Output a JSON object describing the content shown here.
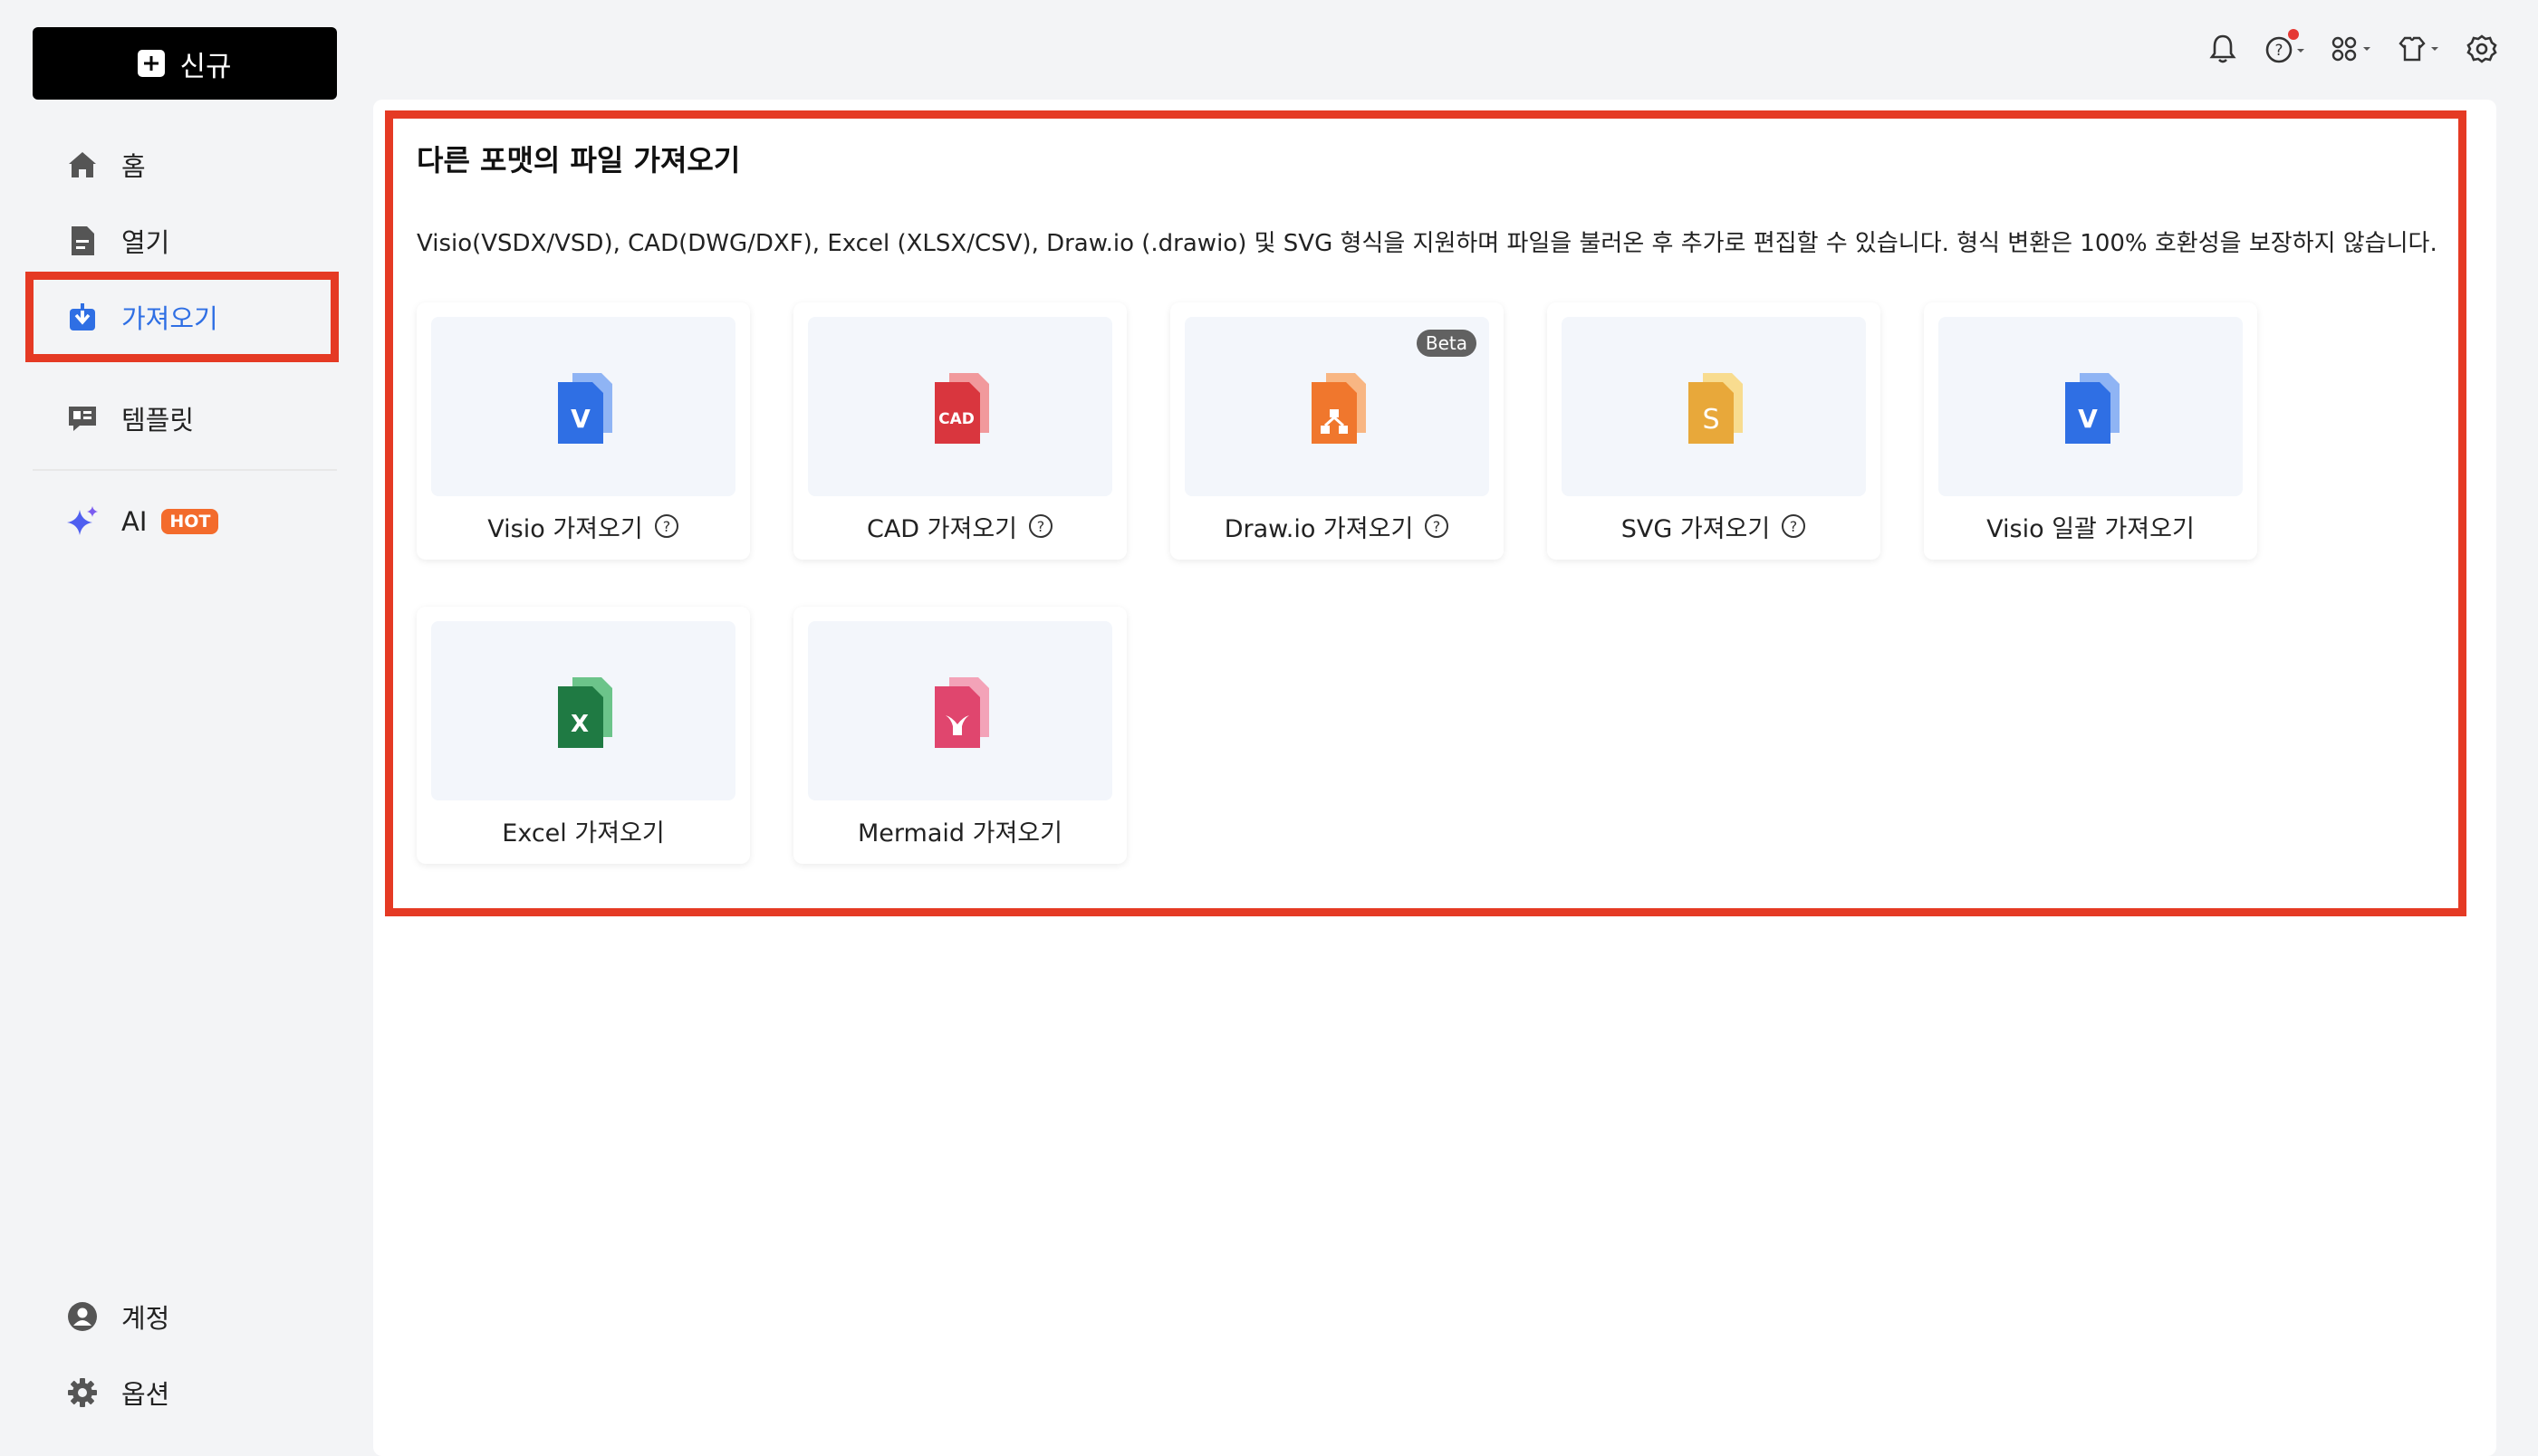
{
  "sidebar": {
    "new_label": "신규",
    "items": [
      {
        "label": "홈",
        "icon": "home-icon"
      },
      {
        "label": "열기",
        "icon": "document-icon"
      },
      {
        "label": "가져오기",
        "icon": "import-icon"
      },
      {
        "label": "템플릿",
        "icon": "template-icon"
      },
      {
        "label": "AI",
        "icon": "sparkle-icon",
        "badge": "HOT"
      }
    ],
    "bottom": [
      {
        "label": "계정",
        "icon": "account-icon"
      },
      {
        "label": "옵션",
        "icon": "gear-icon"
      }
    ]
  },
  "topbar": {
    "icons": [
      "bell-icon",
      "help-icon",
      "apps-icon",
      "shirt-icon",
      "settings-icon"
    ]
  },
  "main": {
    "title": "다른 포맷의 파일 가져오기",
    "description": "Visio(VSDX/VSD), CAD(DWG/DXF), Excel (XLSX/CSV), Draw.io (.drawio) 및 SVG 형식을 지원하며 파일을 불러온 후 추가로 편집할 수 있습니다. 형식 변환은 100% 호환성을 보장하지 않습니다.",
    "cards": [
      {
        "label": "Visio 가져오기",
        "icon": "visio-file-icon",
        "glyph": "V",
        "help": true
      },
      {
        "label": "CAD 가져오기",
        "icon": "cad-file-icon",
        "glyph": "CAD",
        "help": true
      },
      {
        "label": "Draw.io 가져오기",
        "icon": "drawio-file-icon",
        "glyph": "",
        "help": true,
        "badge": "Beta"
      },
      {
        "label": "SVG 가져오기",
        "icon": "svg-file-icon",
        "glyph": "S",
        "help": true
      },
      {
        "label": "Visio 일괄 가져오기",
        "icon": "visio-file-icon",
        "glyph": "V",
        "help": false
      },
      {
        "label": "Excel 가져오기",
        "icon": "excel-file-icon",
        "glyph": "X",
        "help": false
      },
      {
        "label": "Mermaid 가져오기",
        "icon": "mermaid-file-icon",
        "glyph": "",
        "help": false
      }
    ]
  },
  "colors": {
    "accent": "#2f6fe4",
    "highlight": "#e53a24",
    "hot": "#f36b2c",
    "visio": "#2f6fe4",
    "cad": "#d9363e",
    "drawio": "#f0772d",
    "svg": "#e8a83a",
    "excel": "#1f7a43",
    "mermaid": "#e0466e"
  }
}
